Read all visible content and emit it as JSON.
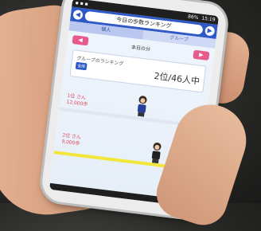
{
  "status_bar": {
    "time": "15:19",
    "battery": "86%"
  },
  "header": {
    "title": "今日の歩数ランキング",
    "prev_arrow": "◀",
    "next_arrow": "▶"
  },
  "tabs": [
    {
      "label": "個人",
      "active": true
    },
    {
      "label": "グループ",
      "active": false
    }
  ],
  "nav": {
    "prev_label": "◀",
    "next_label": "▶",
    "date": "本日の分"
  },
  "rank_card": {
    "label": "グループのランキング",
    "tag": "全体",
    "rank": "2位/46人中"
  },
  "runners": [
    {
      "label_line1": "1位 さん",
      "label_line2": "12,000歩",
      "shirt_color": "#2a3f9a"
    },
    {
      "label_line1": "2位 さん",
      "label_line2": "9,000歩",
      "shirt_color": "#222222"
    }
  ],
  "colors": {
    "accent": "#2e59c7",
    "highlight": "#e85a8c",
    "track": "#f2e63b"
  }
}
